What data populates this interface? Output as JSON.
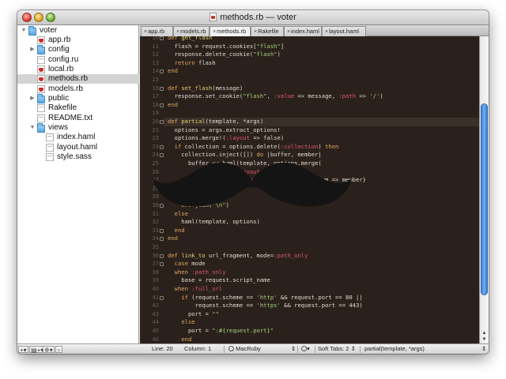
{
  "window": {
    "title": "methods.rb — voter"
  },
  "sidebar": {
    "items": [
      {
        "label": "voter",
        "icon": "folder-icon",
        "expanded": true,
        "depth": 0
      },
      {
        "label": "app.rb",
        "icon": "ruby-file-icon",
        "depth": 1
      },
      {
        "label": "config",
        "icon": "folder-icon",
        "expanded": false,
        "depth": 1
      },
      {
        "label": "config.ru",
        "icon": "text-file-icon",
        "depth": 1
      },
      {
        "label": "local.rb",
        "icon": "ruby-file-icon",
        "depth": 1
      },
      {
        "label": "methods.rb",
        "icon": "ruby-file-icon",
        "depth": 1,
        "selected": true
      },
      {
        "label": "models.rb",
        "icon": "ruby-file-icon",
        "depth": 1
      },
      {
        "label": "public",
        "icon": "folder-icon",
        "expanded": false,
        "depth": 1
      },
      {
        "label": "Rakefile",
        "icon": "text-file-icon",
        "depth": 1
      },
      {
        "label": "README.txt",
        "icon": "text-file-icon",
        "depth": 1
      },
      {
        "label": "views",
        "icon": "folder-icon",
        "expanded": true,
        "depth": 1
      },
      {
        "label": "index.haml",
        "icon": "text-file-icon",
        "depth": 2
      },
      {
        "label": "layout.haml",
        "icon": "text-file-icon",
        "depth": 2
      },
      {
        "label": "style.sass",
        "icon": "text-file-icon",
        "depth": 2
      }
    ],
    "footer": {
      "add": "+",
      "add_folder": "+",
      "action": "✲",
      "info": "○"
    }
  },
  "tabs": [
    {
      "label": "app.rb",
      "active": false
    },
    {
      "label": "models.rb",
      "active": false
    },
    {
      "label": "methods.rb",
      "active": true
    },
    {
      "label": "Rakefile",
      "active": false
    },
    {
      "label": "index.haml",
      "active": false
    },
    {
      "label": "layout.haml",
      "active": false
    }
  ],
  "editor": {
    "current_line": 20,
    "lines": [
      {
        "n": "10",
        "text": "def get_flash",
        "fold": true
      },
      {
        "n": "11",
        "text": "  flash = request.cookies[\"flash\"]"
      },
      {
        "n": "12",
        "text": "  response.delete_cookie(\"flash\")"
      },
      {
        "n": "13",
        "text": "  return flash"
      },
      {
        "n": "14",
        "text": "end",
        "fold": true
      },
      {
        "n": "15",
        "text": ""
      },
      {
        "n": "16",
        "text": "def set_flash(message)",
        "fold": true
      },
      {
        "n": "17",
        "text": "  response.set_cookie(\"flash\", :value => message, :path => '/')"
      },
      {
        "n": "18",
        "text": "end",
        "fold": true
      },
      {
        "n": "19",
        "text": ""
      },
      {
        "n": "20",
        "text": "def partial(template, *args)",
        "fold": true
      },
      {
        "n": "21",
        "text": "  options = args.extract_options!"
      },
      {
        "n": "22",
        "text": "  options.merge!(:layout => false)"
      },
      {
        "n": "23",
        "text": "  if collection = options.delete(:collection) then",
        "fold": true
      },
      {
        "n": "24",
        "text": "    collection.inject([]) do |buffer, member|",
        "fold": true
      },
      {
        "n": "25",
        "text": "      buffer << haml(template, options.merge("
      },
      {
        "n": "26",
        "text": "                    :layout => false,"
      },
      {
        "n": "27",
        "text": "                    :locals => {template.to_sym => member}"
      },
      {
        "n": "28",
        "text": "                  )"
      },
      {
        "n": "29",
        "text": "      )"
      },
      {
        "n": "30",
        "text": "    end.join(\"\\n\")",
        "fold": true
      },
      {
        "n": "31",
        "text": "  else"
      },
      {
        "n": "32",
        "text": "    haml(template, options)"
      },
      {
        "n": "33",
        "text": "  end",
        "fold": true
      },
      {
        "n": "34",
        "text": "end",
        "fold": true
      },
      {
        "n": "35",
        "text": ""
      },
      {
        "n": "36",
        "text": "def link_to url_fragment, mode=:path_only",
        "fold": true
      },
      {
        "n": "37",
        "text": "  case mode",
        "fold": true
      },
      {
        "n": "38",
        "text": "  when :path_only"
      },
      {
        "n": "39",
        "text": "    base = request.script_name"
      },
      {
        "n": "40",
        "text": "  when :full_url"
      },
      {
        "n": "41",
        "text": "    if (request.scheme == 'http' && request.port == 80 ||",
        "fold": true
      },
      {
        "n": "42",
        "text": "        request.scheme == 'https' && request.port == 443)"
      },
      {
        "n": "43",
        "text": "      port = \"\""
      },
      {
        "n": "44",
        "text": "    else"
      },
      {
        "n": "45",
        "text": "      port = \":#{request.port}\""
      },
      {
        "n": "46",
        "text": "    end"
      }
    ]
  },
  "statusbar": {
    "line": "Line: 20",
    "column": "Column: 1",
    "language": "MacRuby",
    "soft_tabs": "Soft Tabs:  2",
    "symbol": "partial(template, *args)"
  },
  "colors": {
    "editor_bg": "#2a211c",
    "keyword": "#e0a75f",
    "string": "#a5d27a",
    "symbol": "#e05a6d",
    "def_name": "#e8cf7a",
    "scrollbar": "#4a90e2"
  }
}
